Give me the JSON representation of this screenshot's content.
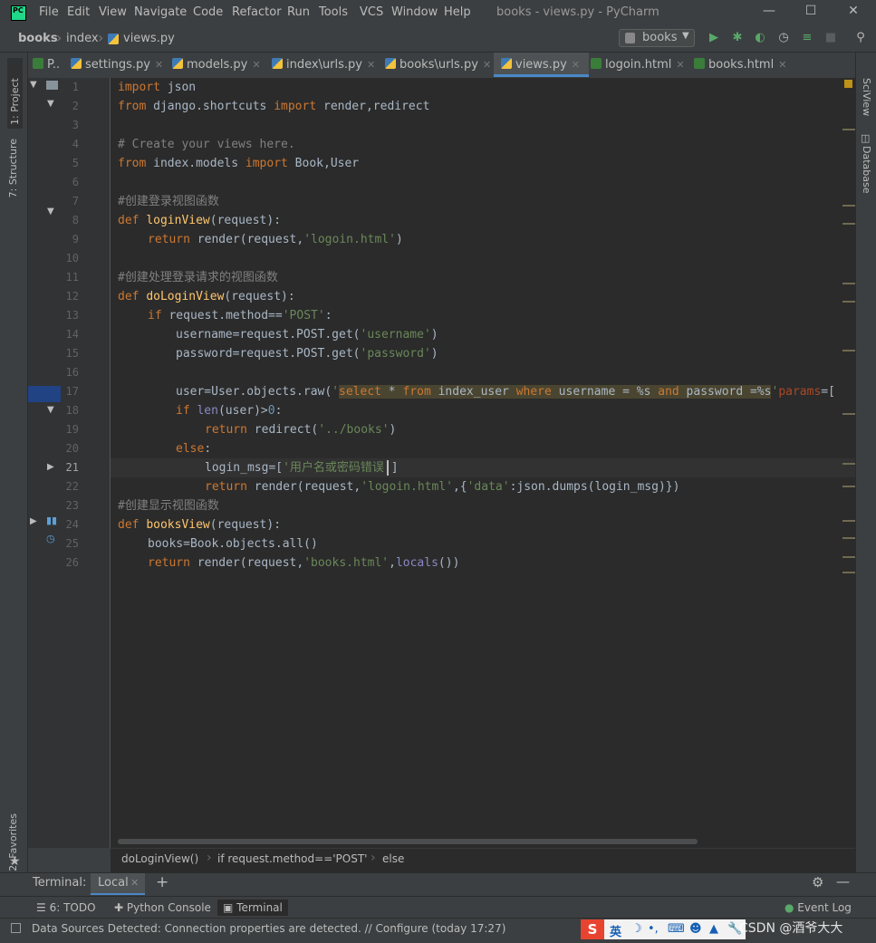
{
  "window": {
    "title": "books - views.py - PyCharm",
    "menu": [
      "File",
      "Edit",
      "View",
      "Navigate",
      "Code",
      "Refactor",
      "Run",
      "Tools",
      "VCS",
      "Window",
      "Help"
    ]
  },
  "navbar": {
    "crumbs": [
      "books",
      "index",
      "views.py"
    ],
    "run_config": "books"
  },
  "tabs": [
    "P..",
    "settings.py",
    "models.py",
    "index\\urls.py",
    "books\\urls.py",
    "views.py",
    "logoin.html",
    "books.html"
  ],
  "left_tools": {
    "project": "1: Project",
    "structure": "7: Structure",
    "favorites": "2: Favorites"
  },
  "right_tools": {
    "sciview": "SciView",
    "database": "Database"
  },
  "editor": {
    "line_numbers": [
      "1",
      "2",
      "3",
      "4",
      "5",
      "6",
      "7",
      "8",
      "9",
      "10",
      "11",
      "12",
      "13",
      "14",
      "15",
      "16",
      "17",
      "18",
      "19",
      "20",
      "21",
      "22",
      "23",
      "24",
      "25",
      "26"
    ],
    "current_line": "21",
    "code": {
      "l1a": "import",
      "l1b": " json",
      "l2a": "from",
      "l2b": " django.shortcuts ",
      "l2c": "import",
      "l2d": " render,redirect",
      "l4": "# Create your views here.",
      "l5a": "from",
      "l5b": " index.models ",
      "l5c": "import",
      "l5d": " Book,User",
      "l7": "#创建登录视图函数",
      "l8a": "def ",
      "l8b": "loginView",
      "l8c": "(request):",
      "l9a": "return",
      "l9b": " render(request,",
      "l9c": "'logoin.html'",
      "l9d": ")",
      "l11": "#创建处理登录请求的视图函数",
      "l12a": "def ",
      "l12b": "doLoginView",
      "l12c": "(request):",
      "l13a": "if",
      "l13b": " request.method==",
      "l13c": "'POST'",
      "l13d": ":",
      "l14a": "username=request.POST.get(",
      "l14b": "'username'",
      "l14c": ")",
      "l15a": "password=request.POST.get(",
      "l15b": "'password'",
      "l15c": ")",
      "l17a": "user=User.objects.raw(",
      "l17b": "'",
      "l17c": "select",
      "l17d": " * ",
      "l17e": "from",
      "l17f": " index_user ",
      "l17g": "where",
      "l17h": " username = %s ",
      "l17i": "and",
      "l17j": " password =%s",
      "l17k": "'",
      ",l17l": ",",
      "l17m": "params",
      "l17n": "=[",
      "l18a": "if",
      "l18b": " ",
      "l18c": "len",
      "l18d": "(user)>",
      "l18e": "0",
      "l18f": ":",
      "l19a": "return",
      "l19b": " redirect(",
      "l19c": "'../books'",
      "l19d": ")",
      "l20a": "else",
      "l20b": ":",
      "l21a": "login_msg=[",
      "l21b": "'用户名或密码错误'",
      "l21c": "]",
      "l22a": "return",
      "l22b": " render(request,",
      "l22c": "'logoin.html'",
      "l22d": ",{",
      "l22e": "'data'",
      "l22f": ":json.dumps(login_msg)})",
      "l23": "#创建显示视图函数",
      "l24a": "def ",
      "l24b": "booksView",
      "l24c": "(request):",
      "l25": "books=Book.objects.all()",
      "l26a": "return",
      "l26b": " render(request,",
      "l26c": "'books.html'",
      "l26d": ",",
      "l26e": "locals",
      "l26f": "())"
    }
  },
  "code_breadcrumbs": [
    "doLoginView()",
    "if request.method=='POST'",
    "else"
  ],
  "terminal": {
    "label": "Terminal:",
    "tab": "Local",
    "add": "+"
  },
  "tool_windows": {
    "todo": "6: TODO",
    "console": "Python Console",
    "terminal": "Terminal",
    "event_log": "Event Log"
  },
  "status": "Data Sources Detected: Connection properties are detected. // Configure (today 17:27)",
  "ime": {
    "lang": "英",
    "watermark": "CSDN @酒爷大大"
  },
  "colors": {
    "bg": "#3c3f41",
    "editor": "#2b2b2b",
    "keyword": "#cc7832",
    "string": "#6a8759",
    "function": "#ffc66d",
    "accent": "#4a88c7"
  }
}
